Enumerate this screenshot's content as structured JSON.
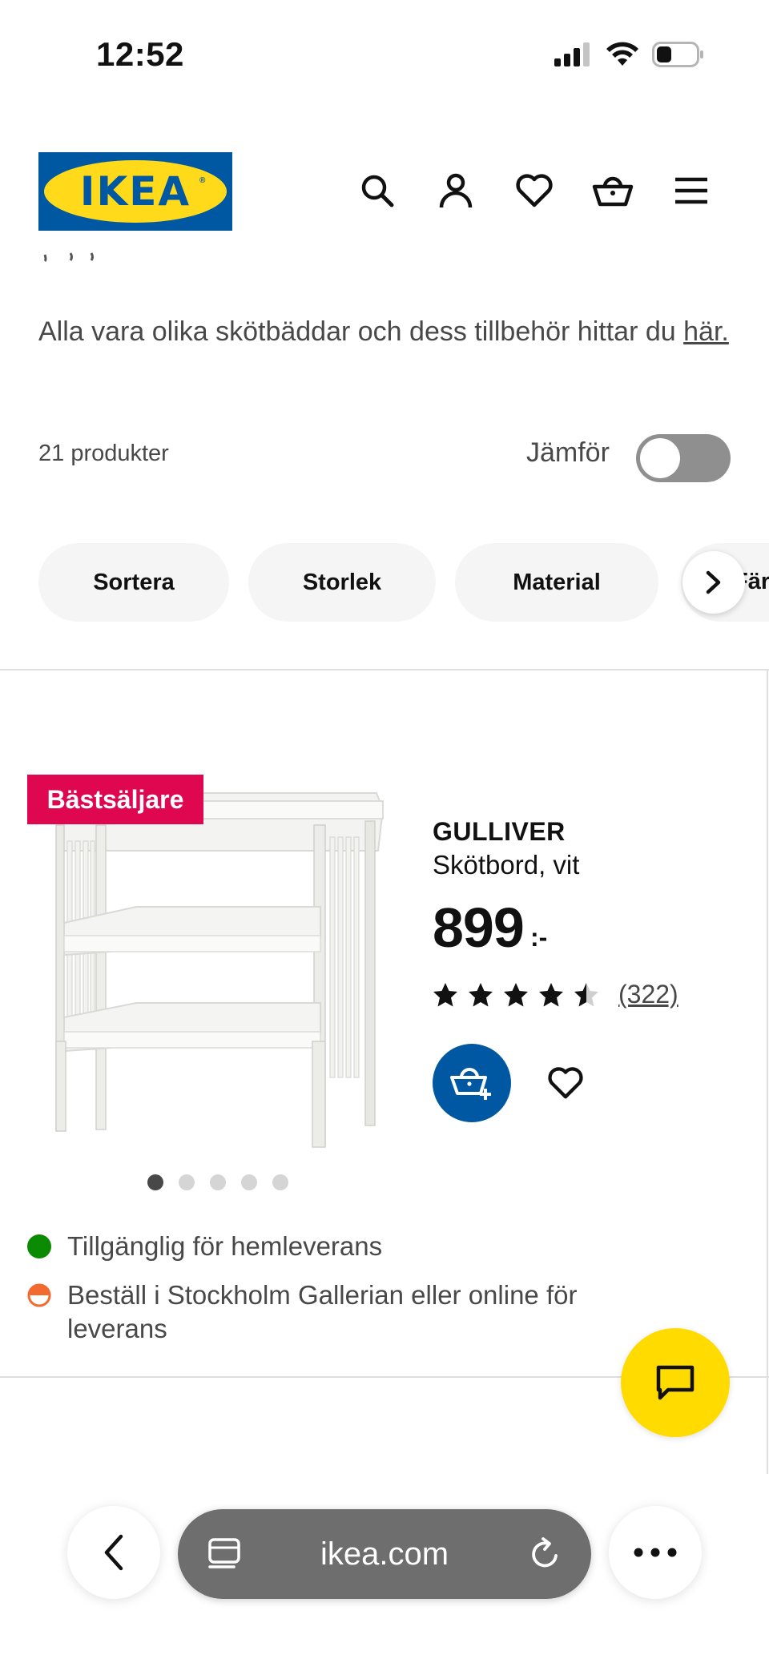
{
  "status_bar": {
    "time": "12:52"
  },
  "header": {
    "logo_text": "IKEA",
    "icons": [
      "search-icon",
      "account-icon",
      "heart-icon",
      "cart-icon",
      "menu-icon"
    ]
  },
  "intro": {
    "text": "Alla vara olika skötbäddar och dess tillbehör hittar du",
    "link_text": "här."
  },
  "listing": {
    "count_label": "21 produkter",
    "compare_label": "Jämför",
    "compare_on": false
  },
  "filters": {
    "pills": [
      "Sortera",
      "Storlek",
      "Material"
    ],
    "cut_pill_text": "Färg"
  },
  "product": {
    "badge": "Bästsäljare",
    "name": "GULLIVER",
    "description": "Skötbord, vit",
    "price": "899",
    "price_suffix": ":-",
    "rating": 4.5,
    "review_count": "(322)",
    "image_count": 5,
    "active_image": 0,
    "availability": [
      {
        "text": "Tillgänglig för hemleverans",
        "status": "green",
        "color": "#0a8a00"
      },
      {
        "text": "Beställ i Stockholm Gallerian eller online för leverans",
        "status": "partial",
        "color": "#f26a2e"
      }
    ]
  },
  "browser": {
    "url": "ikea.com"
  },
  "colors": {
    "ikea_blue": "#0058a3",
    "ikea_yellow": "#ffda1a",
    "badge_red": "#e00751",
    "chat_yellow": "#ffdb00"
  }
}
